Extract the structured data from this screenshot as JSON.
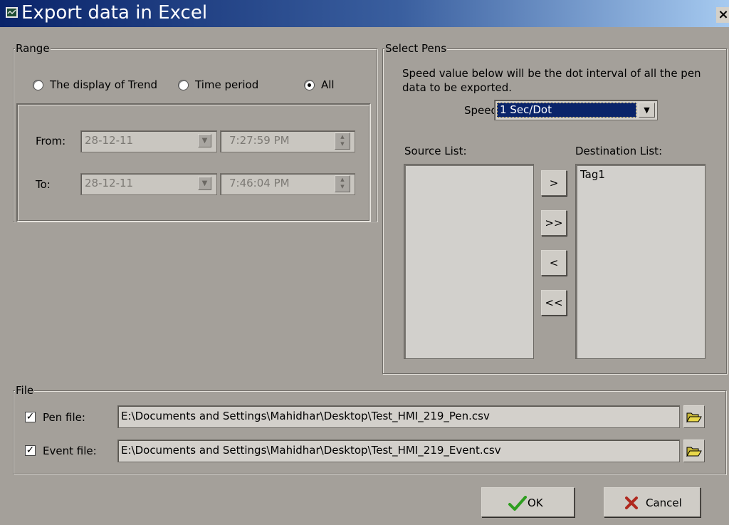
{
  "window": {
    "title": "Export data in Excel",
    "close_glyph": "×"
  },
  "range": {
    "legend": "Range",
    "options": [
      "The display of Trend",
      "Time period",
      "All"
    ],
    "selected": "All",
    "from_label": "From:",
    "to_label": "To:",
    "from_date": "28-12-11",
    "from_time": "7:27:59 PM",
    "to_date": "28-12-11",
    "to_time": "7:46:04 PM"
  },
  "pens": {
    "legend": "Select Pens",
    "description": "Speed value below will be the dot interval of all the pen data to be exported.",
    "speed_label": "Speed:",
    "speed_value": "1 Sec/Dot",
    "source_label": "Source List:",
    "destination_label": "Destination List:",
    "source_items": [],
    "destination_items": [
      "Tag1"
    ],
    "buttons": [
      ">",
      ">>",
      "<",
      "<<"
    ]
  },
  "file": {
    "legend": "File",
    "pen_label": "Pen file:",
    "pen_checked": true,
    "pen_path": "E:\\Documents and Settings\\Mahidhar\\Desktop\\Test_HMI_219_Pen.csv",
    "event_label": "Event file:",
    "event_checked": true,
    "event_path": "E:\\Documents and Settings\\Mahidhar\\Desktop\\Test_HMI_219_Event.csv"
  },
  "actions": {
    "ok_label": "OK",
    "cancel_label": "Cancel"
  },
  "colors": {
    "title_gradient_start": "#0a246a",
    "title_gradient_end": "#a6caf0",
    "dialog_background": "#a4a09a",
    "selection_highlight": "#0a246a",
    "ok_check": "#2e9e1f",
    "cancel_x": "#b0281e",
    "folder_icon": "#e8d74a"
  },
  "icons": {
    "title": "trend-chart-icon",
    "ok": "checkmark-icon",
    "cancel": "x-icon",
    "browse": "folder-open-icon"
  }
}
